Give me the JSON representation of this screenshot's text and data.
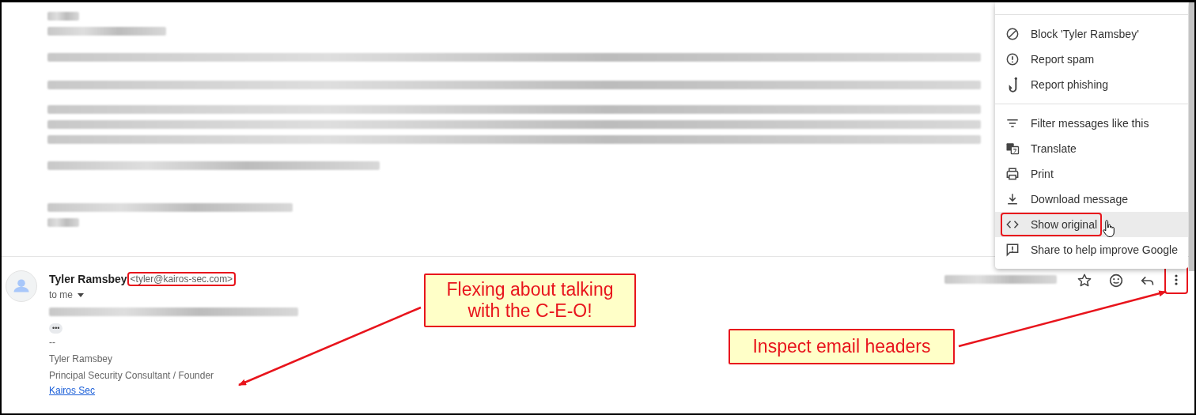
{
  "menu": {
    "groups": [
      {
        "items": [
          {
            "label": "Block 'Tyler Ramsbey'",
            "hovered": false,
            "outlined": false
          },
          {
            "label": "Report spam",
            "hovered": false,
            "outlined": false
          },
          {
            "label": "Report phishing",
            "hovered": false,
            "outlined": false
          }
        ]
      },
      {
        "items": [
          {
            "label": "Filter messages like this",
            "hovered": false,
            "outlined": false
          },
          {
            "label": "Translate",
            "hovered": false,
            "outlined": false
          },
          {
            "label": "Print",
            "hovered": false,
            "outlined": false
          },
          {
            "label": "Download message",
            "hovered": false,
            "outlined": false
          },
          {
            "label": "Show original",
            "hovered": true,
            "outlined": true
          },
          {
            "label": "Share to help improve Google",
            "hovered": false,
            "outlined": false
          }
        ]
      }
    ]
  },
  "message": {
    "sender_name": "Tyler Ramsbey",
    "sender_email": {
      "text": "<tyler@kairos-sec.com>",
      "outlined": true
    },
    "recipient": "to me",
    "trimmed_toggle": "•••",
    "signature": [
      "--",
      "Tyler Ramsbey",
      "Principal Security Consultant / Founder"
    ],
    "signature_link": "Kairos Sec",
    "more_button": {
      "outlined": true
    }
  },
  "callouts": [
    "Flexing about talking with the C-E-O!",
    "Inspect email headers"
  ]
}
